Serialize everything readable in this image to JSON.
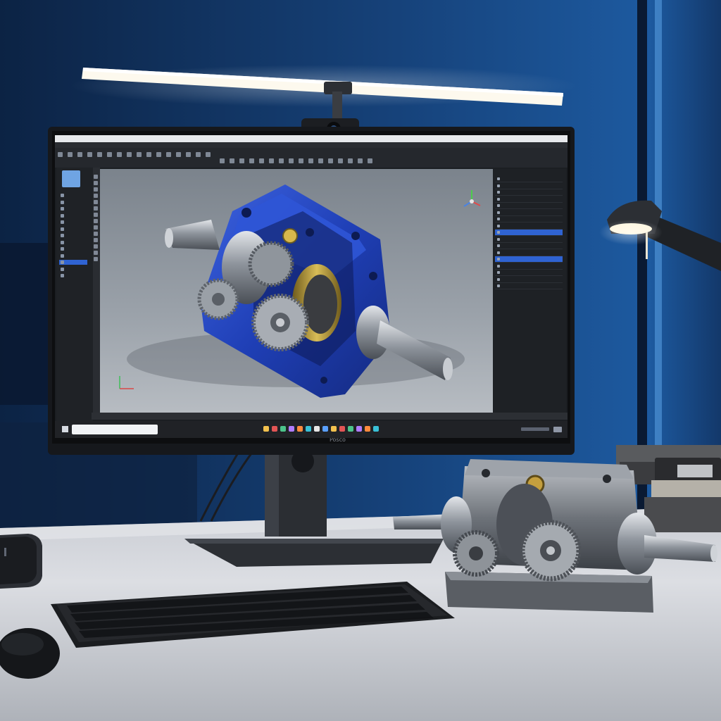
{
  "cad_app": {
    "toolbar_icons": [
      "new-icon",
      "open-icon",
      "save-icon",
      "undo-icon",
      "redo-icon",
      "sketch-icon",
      "extrude-icon",
      "revolve-icon",
      "fillet-icon",
      "chamfer-icon",
      "hole-icon",
      "pattern-icon",
      "mirror-icon",
      "measure-icon",
      "section-icon",
      "render-icon"
    ],
    "left_panel_items": [
      "",
      "",
      "",
      "",
      "",
      "",
      "",
      "",
      "",
      "",
      "",
      "",
      ""
    ],
    "tree_rows": [
      "",
      "",
      "",
      "",
      "",
      "",
      "",
      "",
      "",
      "",
      "",
      "",
      "",
      "",
      "",
      "",
      ""
    ],
    "selected_tree_rows": [
      8,
      12
    ],
    "selected_left_item": 10,
    "view_axes_icon": "view-axes-icon",
    "coord_icon": "coordinate-system-icon"
  },
  "taskbar": {
    "search_placeholder": "",
    "icons": [
      "windows-icon",
      "search-icon",
      "task-view-icon",
      "folder-icon",
      "browser-icon",
      "mail-icon",
      "cad-icon",
      "store-icon",
      "settings-icon",
      "photos-icon",
      "music-icon",
      "chat-icon",
      "camera-icon",
      "terminal-icon",
      "office-icon"
    ]
  },
  "colors": {
    "cad_blue": "#1f3fb6",
    "selection_blue": "#2f63d2",
    "ui_dark": "#1b1e22",
    "viewport_grey": "#8e969e",
    "steel": "#9ea3aa",
    "brass": "#b89a3a"
  },
  "scene": {
    "objects": [
      "led-light-bar",
      "webcam",
      "monitor",
      "keyboard",
      "mouse",
      "desk-lamp",
      "gearbox-model",
      "book-stack",
      "speaker"
    ]
  }
}
